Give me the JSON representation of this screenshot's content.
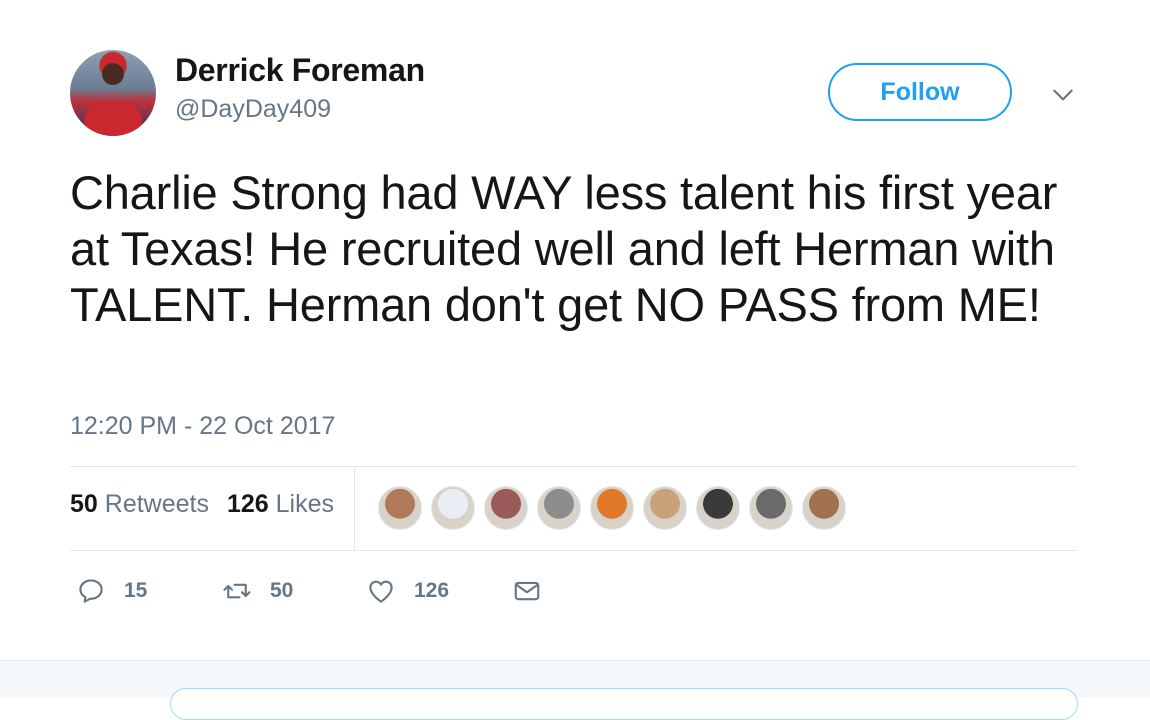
{
  "author": {
    "name": "Derrick Foreman",
    "handle": "@DayDay409",
    "avatar_icon": "user-avatar"
  },
  "follow_label": "Follow",
  "tweet": {
    "text": "Charlie Strong had WAY less talent his first year at Texas! He recruited well and left Herman with TALENT. Herman don't get NO PASS from ME!",
    "timestamp": "12:20 PM - 22 Oct 2017"
  },
  "stats": {
    "retweets_count": "50",
    "retweets_label": "Retweets",
    "likes_count": "126",
    "likes_label": "Likes"
  },
  "likers": [
    {
      "color": "#b07a5a"
    },
    {
      "color": "#e9eef5"
    },
    {
      "color": "#9a5a5a"
    },
    {
      "color": "#8c8c8c"
    },
    {
      "color": "#e07a2a"
    },
    {
      "color": "#c9a27a"
    },
    {
      "color": "#3a3a3a"
    },
    {
      "color": "#6a6a6a"
    },
    {
      "color": "#a07050"
    }
  ],
  "actions": {
    "reply_count": "15",
    "retweet_count": "50",
    "like_count": "126"
  },
  "colors": {
    "accent": "#1da1f2",
    "text_primary": "#14171a",
    "text_secondary": "#657786"
  }
}
